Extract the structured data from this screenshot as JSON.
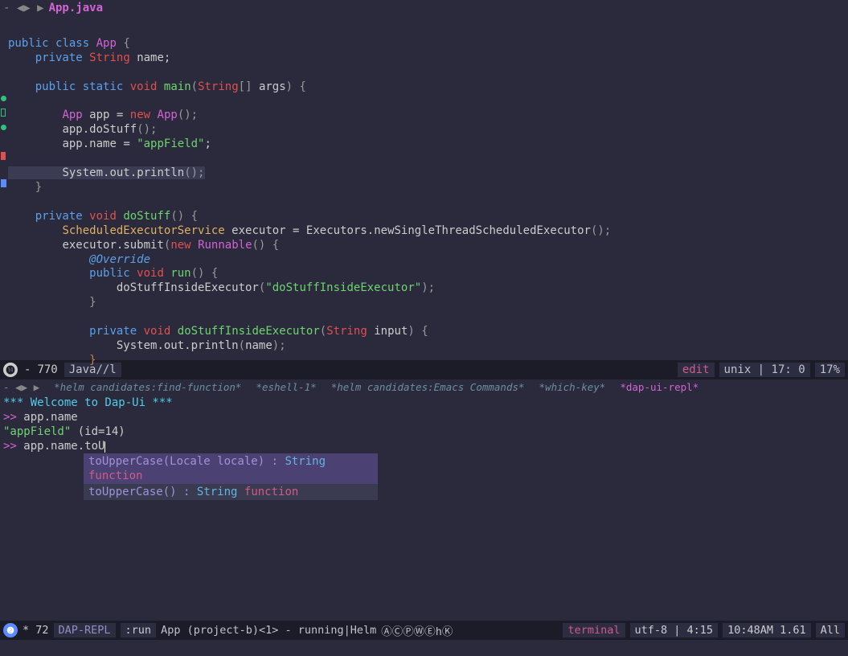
{
  "topbar": {
    "marks": "- ◀▶ ▶",
    "filename": "App.java"
  },
  "code": {
    "kw_public": "public",
    "kw_class": "class",
    "kw_static": "static",
    "kw_private": "private",
    "kw_void": "void",
    "kw_new": "new",
    "ty_string": "String",
    "ty_void": "void",
    "cls_app": "App",
    "cls_executors": "Executors",
    "cls_runnable": "Runnable",
    "ty_sched": "ScheduledExecutorService",
    "fn_main": "main",
    "fn_dostuff": "doStuff",
    "fn_run": "run",
    "fn_dostuffin": "doStuffInsideExecutor",
    "fn_newsched": "newSingleThreadScheduledExecutor",
    "var_name": "name",
    "var_args": "args",
    "var_app": "app",
    "var_executor": "executor",
    "var_input": "input",
    "str_appfield": "\"appField\"",
    "str_dostuffin": "\"doStuffInsideExecutor\"",
    "ann_override": "@Override",
    "sys": "System",
    "out": "out",
    "println": "println",
    "submit": "submit"
  },
  "mode1": {
    "badge": "⓮",
    "flag": "-",
    "num": "770",
    "mode": "Java//l",
    "edit": "edit",
    "enc": "unix",
    "pos": "17: 0",
    "pct": "17%"
  },
  "tabs": {
    "marks": "- ◀▶ ▶",
    "t1": "*helm candidates:find-function*",
    "t2": "*eshell-1*",
    "t3": "*helm candidates:Emacs Commands*",
    "t4": "*which-key*",
    "active": "*dap-ui-repl*"
  },
  "repl": {
    "welcome": "*** Welcome to Dap-Ui ***",
    "prompt": ">>",
    "line1": "app.name",
    "out1a": "\"appField\"",
    "out1b": "(id=14)",
    "line2": "app.name.toU",
    "pop1_name": "toUpperCase(Locale locale) :",
    "pop1_ret": "String",
    "pop1_kind": "function",
    "pop2_name": "toUpperCase() :",
    "pop2_ret": "String",
    "pop2_kind": "function"
  },
  "mode2": {
    "badge": "❷",
    "flag": "* 72",
    "replmode": "DAP-REPL",
    "cmd": ":run",
    "proj": "App (project-b)<1> - running|Helm",
    "circles": "ⒶⒸⓅⓌⒺhⓀ",
    "term": "terminal",
    "enc": "utf-8",
    "pos": "4:15",
    "time": "10:48AM 1.61",
    "pct": "All"
  }
}
